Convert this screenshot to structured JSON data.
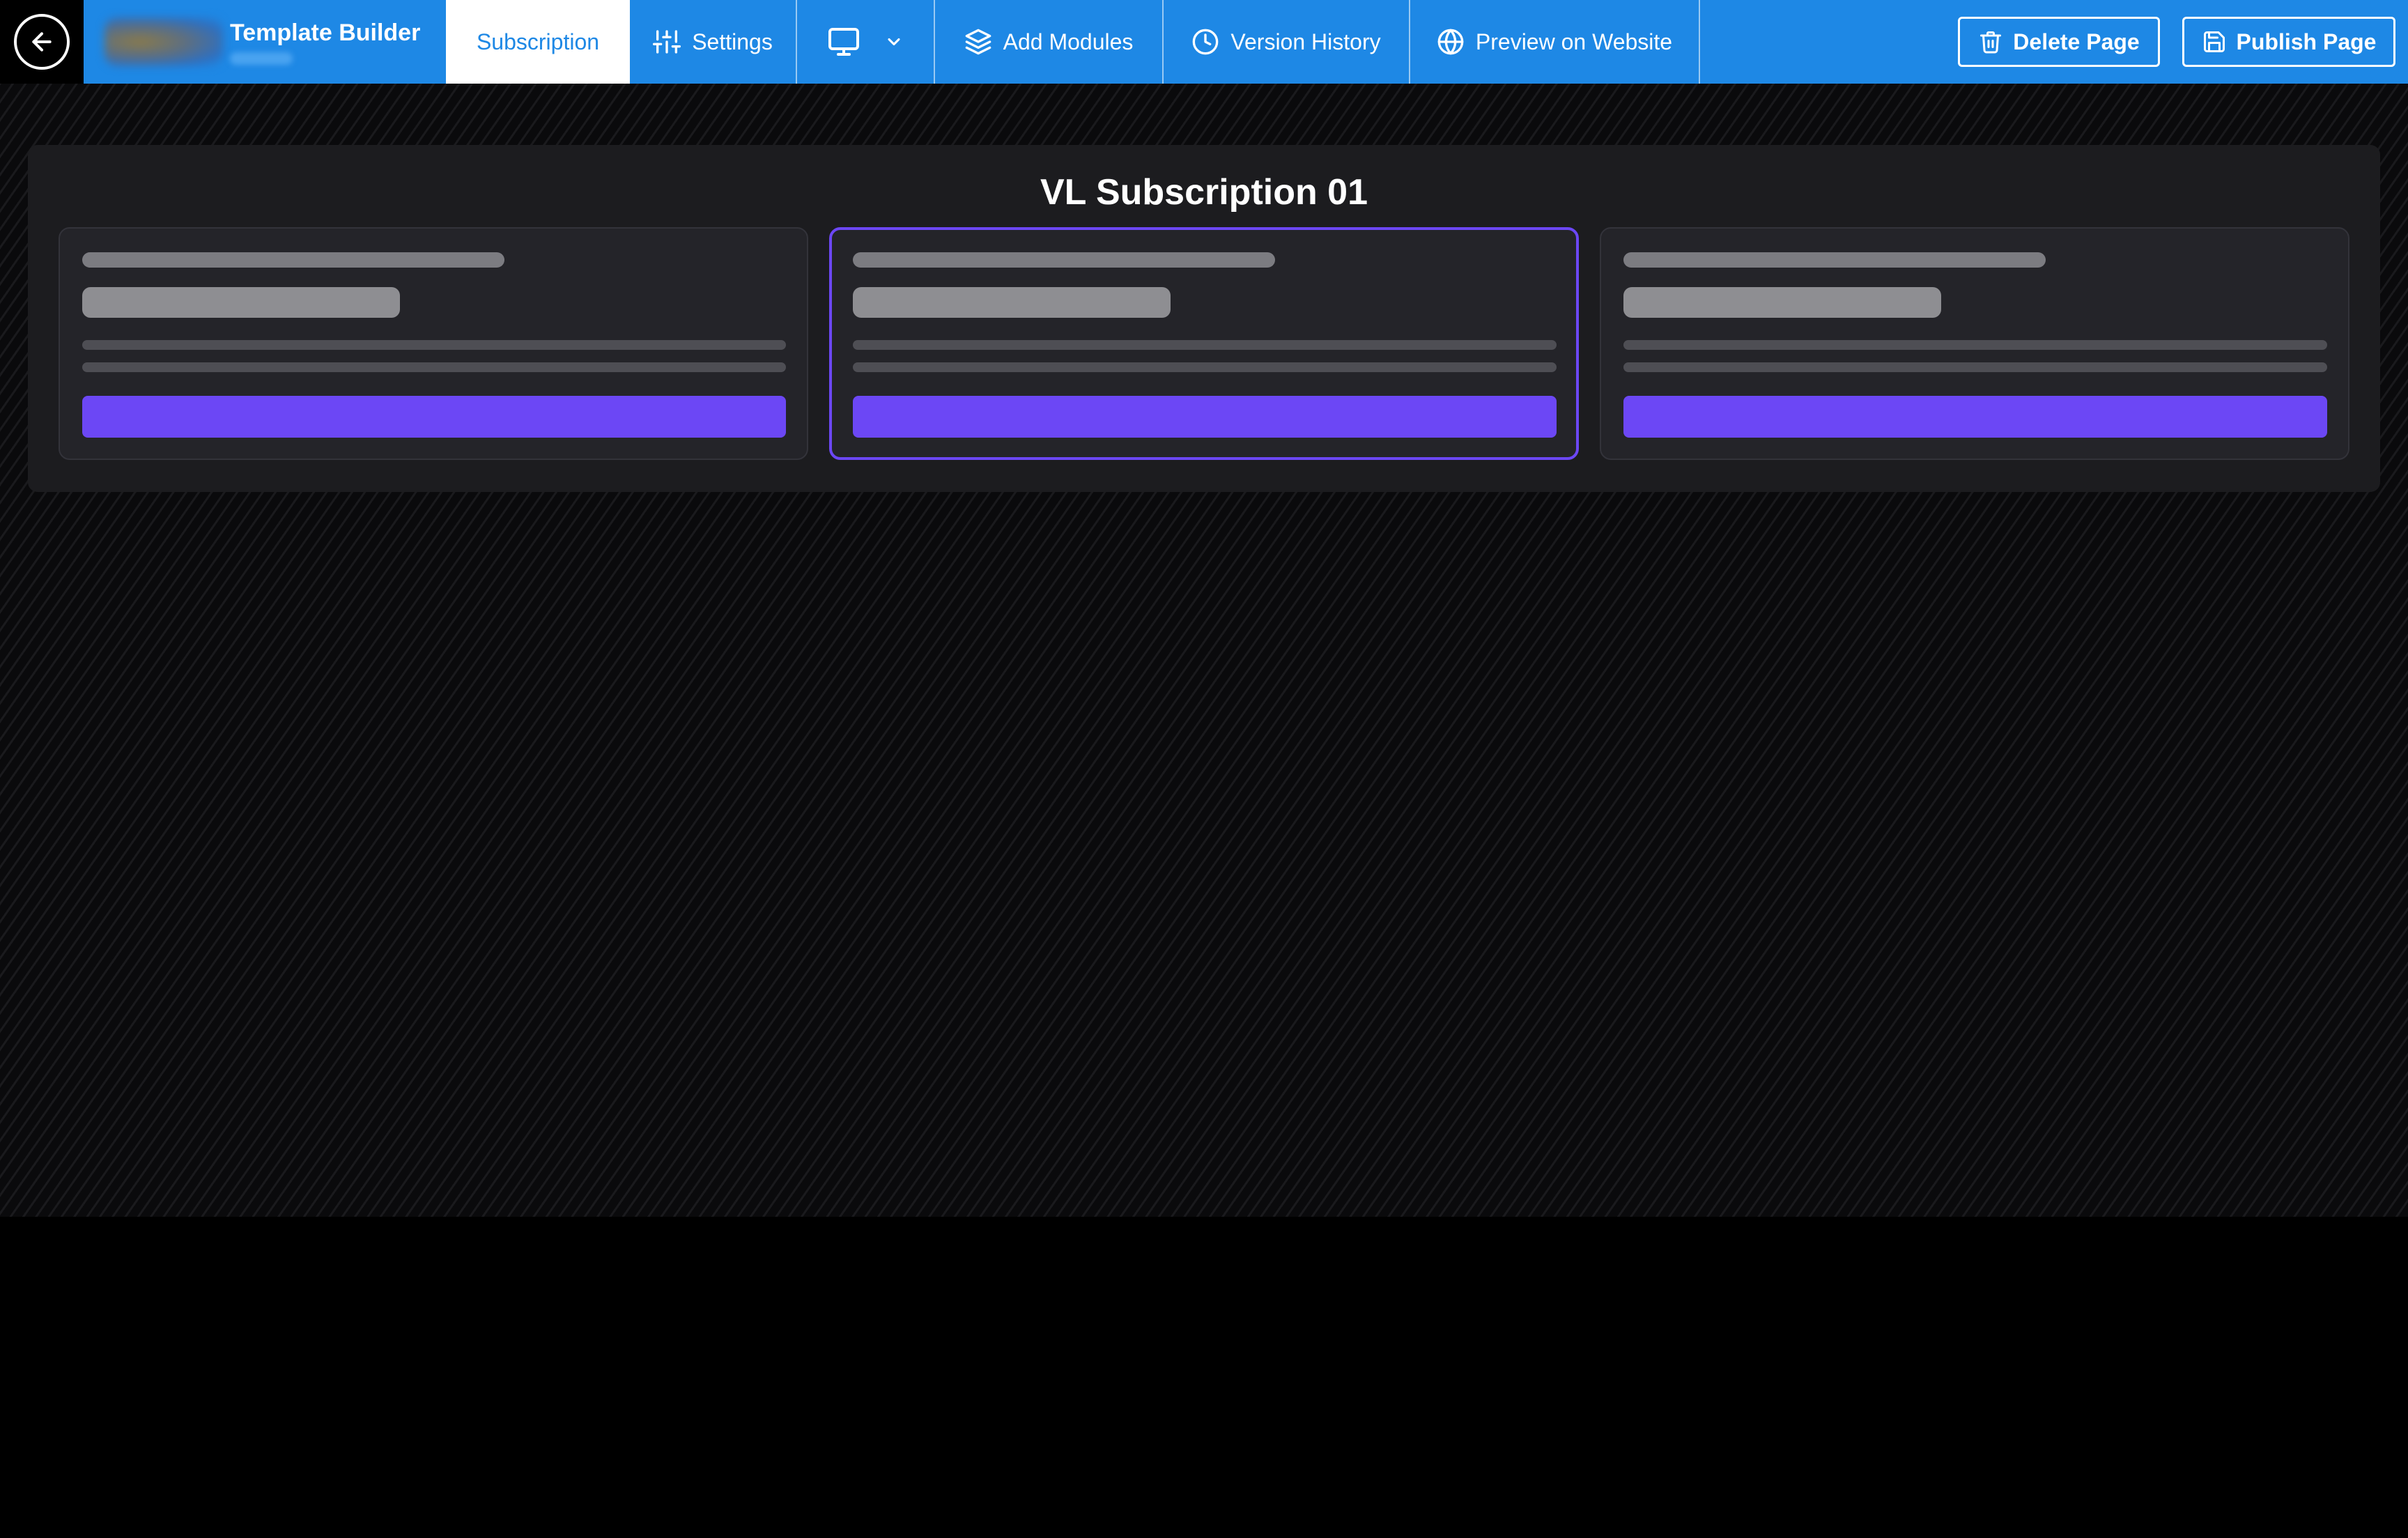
{
  "header": {
    "app_title": "Template Builder",
    "tabs": [
      {
        "label": "Subscription",
        "icon": "none",
        "active": true
      },
      {
        "label": "Settings",
        "icon": "sliders-icon"
      },
      {
        "label": "",
        "icon": "monitor-icon"
      },
      {
        "label": "Add Modules",
        "icon": "layers-icon"
      },
      {
        "label": "Version History",
        "icon": "clock-icon"
      },
      {
        "label": "Preview on Website",
        "icon": "globe-icon"
      }
    ],
    "actions": {
      "delete_label": "Delete Page",
      "publish_label": "Publish Page"
    }
  },
  "module": {
    "title": "VL Subscription 01",
    "cards_count": 3,
    "selected_card": 2
  },
  "colors": {
    "header_bg": "#1e88e5",
    "accent_purple": "#6c47f5",
    "module_bg": "#1c1c1f",
    "card_bg": "#242429"
  }
}
